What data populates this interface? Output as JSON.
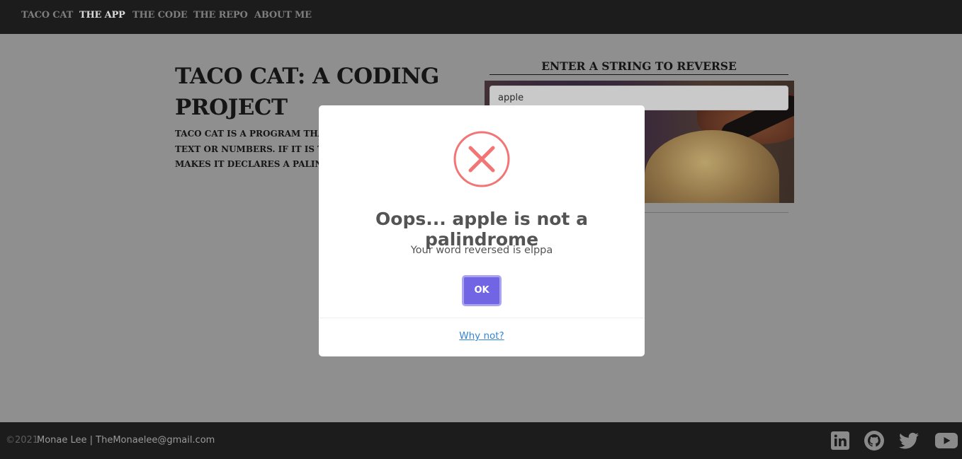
{
  "nav": {
    "brand": "TACO CAT",
    "items": [
      {
        "label": "THE APP",
        "active": true
      },
      {
        "label": "THE CODE",
        "active": false
      },
      {
        "label": "THE REPO",
        "active": false
      },
      {
        "label": "ABOUT ME",
        "active": false
      }
    ]
  },
  "main": {
    "title": "TACO CAT: A CODING PROJECT",
    "description": "TACO CAT IS A PROGRAM THA\nTEXT OR NUMBERS. IF IT IS T\nMAKES IT DECLARES A PALIN",
    "form_heading": "ENTER A STRING TO REVERSE",
    "input_value": "apple"
  },
  "modal": {
    "icon": "error-x-icon",
    "title": "Oops... apple is not a palindrome",
    "text": "Your word reversed is elppa",
    "ok_label": "OK",
    "footer_link": "Why not?"
  },
  "footer": {
    "copyright": "©2021",
    "author": "Monae Lee | TheMonaelee@gmail.com",
    "social": [
      "linkedin-icon",
      "github-icon",
      "twitter-icon",
      "youtube-icon"
    ]
  },
  "colors": {
    "nav_bg": "#1c1c1c",
    "overlay": "#8f8f8f",
    "ok_button": "#7165e3",
    "error_icon": "#f27474",
    "link": "#3085d6"
  }
}
